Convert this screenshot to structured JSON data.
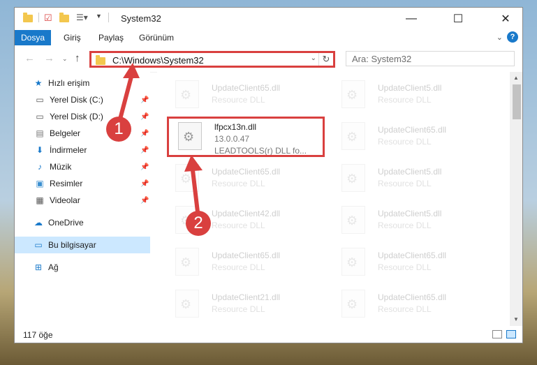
{
  "window": {
    "title": "System32",
    "minimize_icon": "—",
    "maximize_icon": "☐",
    "close_icon": "✕"
  },
  "ribbon": {
    "file_tab": "Dosya",
    "tabs": [
      "Giriş",
      "Paylaş",
      "Görünüm"
    ]
  },
  "address": {
    "path": "C:\\Windows\\System32",
    "search_placeholder": "Ara: System32"
  },
  "sidebar": {
    "items": [
      {
        "label": "Hızlı erişim",
        "icon": "star-icon"
      },
      {
        "label": "Yerel Disk (C:)",
        "icon": "drive-icon",
        "pinned": true
      },
      {
        "label": "Yerel Disk (D:)",
        "icon": "drive-icon",
        "pinned": true
      },
      {
        "label": "Belgeler",
        "icon": "documents-icon",
        "pinned": true
      },
      {
        "label": "İndirmeler",
        "icon": "downloads-icon",
        "pinned": true
      },
      {
        "label": "Müzik",
        "icon": "music-icon",
        "pinned": true
      },
      {
        "label": "Resimler",
        "icon": "pictures-icon",
        "pinned": true
      },
      {
        "label": "Videolar",
        "icon": "videos-icon",
        "pinned": true
      },
      {
        "label": "OneDrive",
        "icon": "cloud-icon"
      },
      {
        "label": "Bu bilgisayar",
        "icon": "computer-icon",
        "selected": true
      },
      {
        "label": "Ağ",
        "icon": "network-icon"
      }
    ]
  },
  "files": {
    "left": [
      {
        "name": "UpdateClient65.dll",
        "type": "Resource DLL"
      },
      {
        "name": "lfpcx13n.dll",
        "version": "13.0.0.47",
        "desc": "LEADTOOLS(r) DLL fo..."
      },
      {
        "name": "UpdateClient65.dll",
        "type": "Resource DLL"
      },
      {
        "name": "UpdateClient42.dll",
        "type": "Resource DLL"
      },
      {
        "name": "UpdateClient65.dll",
        "type": "Resource DLL"
      },
      {
        "name": "UpdateClient21.dll",
        "type": "Resource DLL"
      }
    ],
    "right": [
      {
        "name": "UpdateClient5.dll",
        "type": "Resource DLL"
      },
      {
        "name": "UpdateClient65.dll",
        "type": "Resource DLL"
      },
      {
        "name": "UpdateClient5.dll",
        "type": "Resource DLL"
      },
      {
        "name": "UpdateClient5.dll",
        "type": "Resource DLL"
      },
      {
        "name": "UpdateClient65.dll",
        "type": "Resource DLL"
      },
      {
        "name": "UpdateClient65.dll",
        "type": "Resource DLL"
      }
    ]
  },
  "status": {
    "item_count": "117 öğe"
  },
  "callouts": {
    "step1": "1",
    "step2": "2"
  },
  "colors": {
    "accent": "#1979ca",
    "highlight": "#d9403f",
    "selected_bg": "#cce8ff"
  }
}
